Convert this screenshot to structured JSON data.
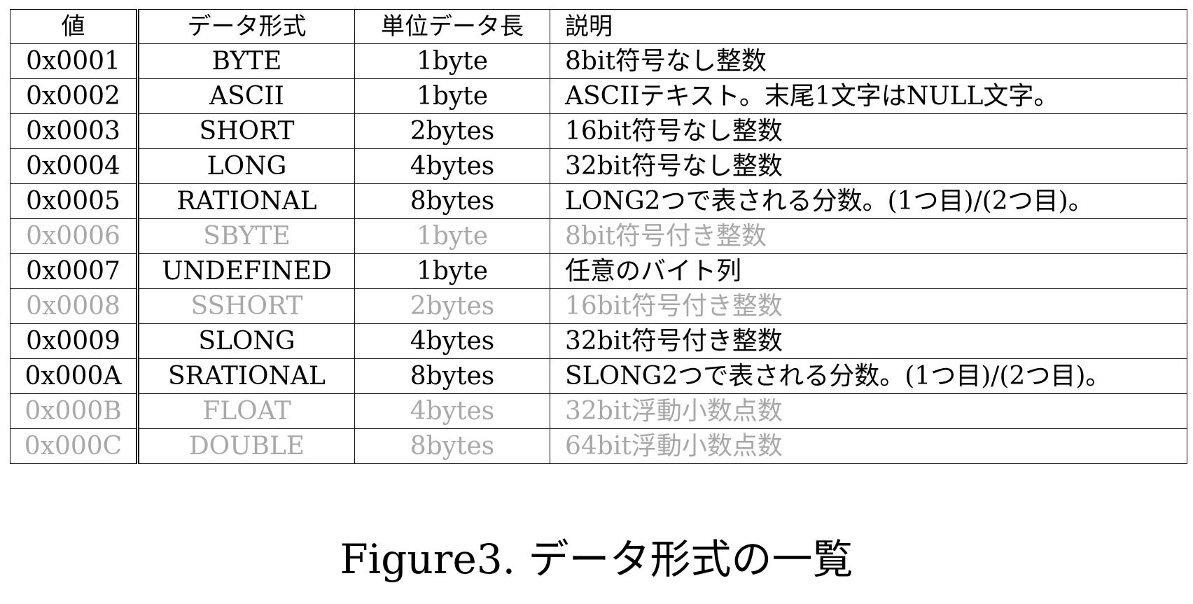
{
  "table": {
    "headers": {
      "value": "値",
      "format": "データ形式",
      "unit": "単位データ長",
      "description": "説明"
    },
    "rows": [
      {
        "value": "0x0001",
        "format": "BYTE",
        "unit": "1byte",
        "description": "8bit符号なし整数",
        "disabled": false
      },
      {
        "value": "0x0002",
        "format": "ASCII",
        "unit": "1byte",
        "description": "ASCIIテキスト。末尾1文字はNULL文字。",
        "disabled": false
      },
      {
        "value": "0x0003",
        "format": "SHORT",
        "unit": "2bytes",
        "description": "16bit符号なし整数",
        "disabled": false
      },
      {
        "value": "0x0004",
        "format": "LONG",
        "unit": "4bytes",
        "description": "32bit符号なし整数",
        "disabled": false
      },
      {
        "value": "0x0005",
        "format": "RATIONAL",
        "unit": "8bytes",
        "description": "LONG2つで表される分数。(1つ目)/(2つ目)。",
        "disabled": false
      },
      {
        "value": "0x0006",
        "format": "SBYTE",
        "unit": "1byte",
        "description": "8bit符号付き整数",
        "disabled": true
      },
      {
        "value": "0x0007",
        "format": "UNDEFINED",
        "unit": "1byte",
        "description": "任意のバイト列",
        "disabled": false
      },
      {
        "value": "0x0008",
        "format": "SSHORT",
        "unit": "2bytes",
        "description": "16bit符号付き整数",
        "disabled": true
      },
      {
        "value": "0x0009",
        "format": "SLONG",
        "unit": "4bytes",
        "description": "32bit符号付き整数",
        "disabled": false
      },
      {
        "value": "0x000A",
        "format": "SRATIONAL",
        "unit": "8bytes",
        "description": "SLONG2つで表される分数。(1つ目)/(2つ目)。",
        "disabled": false
      },
      {
        "value": "0x000B",
        "format": "FLOAT",
        "unit": "4bytes",
        "description": "32bit浮動小数点数",
        "disabled": true
      },
      {
        "value": "0x000C",
        "format": "DOUBLE",
        "unit": "8bytes",
        "description": "64bit浮動小数点数",
        "disabled": true
      }
    ]
  },
  "caption": "Figure3.  データ形式の一覧",
  "colors": {
    "text": "#000000",
    "disabled_text": "#a8a8a8",
    "border": "#111111",
    "background": "#ffffff"
  }
}
